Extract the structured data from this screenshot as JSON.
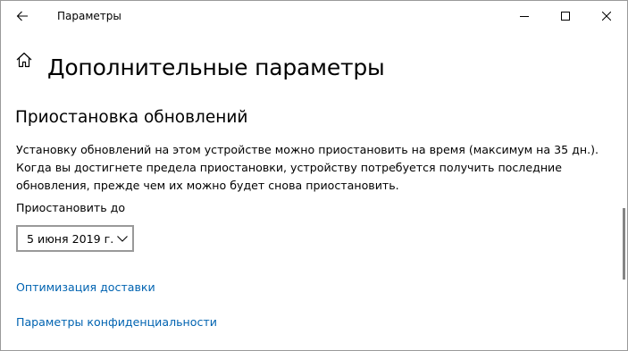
{
  "window": {
    "title": "Параметры",
    "back_icon": "arrow-left-icon",
    "controls": [
      "minimize-icon",
      "maximize-icon",
      "close-icon"
    ]
  },
  "header": {
    "home_icon": "home-icon",
    "title": "Дополнительные параметры"
  },
  "pause_section": {
    "title": "Приостановка обновлений",
    "description": "Установку обновлений на этом устройстве можно приостановить на время (максимум на 35 дн.). Когда вы достигнете предела приостановки, устройству потребуется получить последние обновления, прежде чем их можно будет снова приостановить.",
    "pause_until_label": "Приостановить до",
    "pause_until_value": "5 июня 2019 г."
  },
  "links": {
    "delivery_optimization": "Оптимизация доставки",
    "privacy_settings": "Параметры конфиденциальности"
  },
  "colors": {
    "link": "#0063b1",
    "scrollbar": "#858585",
    "window_border": "#9a9a9a"
  }
}
